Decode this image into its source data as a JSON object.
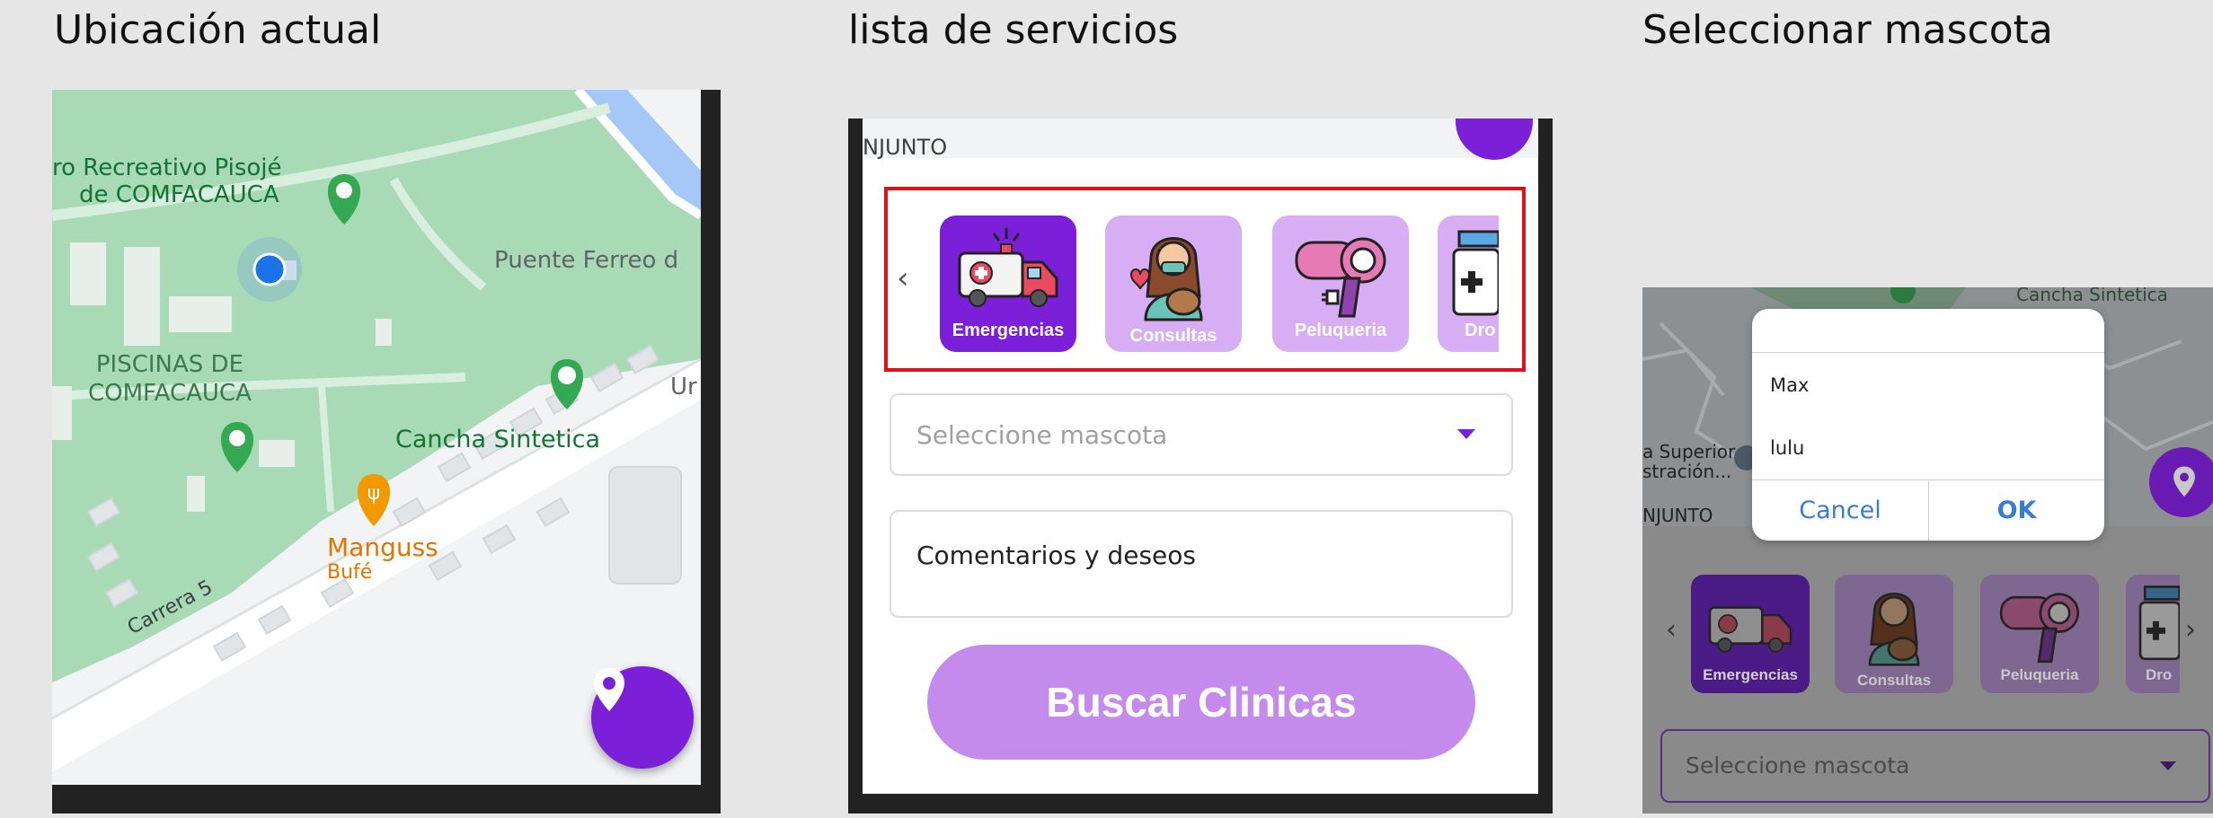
{
  "captions": {
    "left": "Ubicación actual",
    "middle": "lista de servicios",
    "right": "Seleccionar mascota"
  },
  "map1": {
    "labels": {
      "recreativo_1": "ro Recreativo Pisojé",
      "recreativo_2": "de COMFACAUCA",
      "puente": "Puente Ferreo d",
      "piscinas_1": "PISCINAS DE",
      "piscinas_2": "COMFACAUCA",
      "ur": "Ur",
      "cancha": "Cancha Sintetica",
      "manguss": "Manguss",
      "bufe": "Bufé",
      "carrera": "Carrera 5"
    }
  },
  "services": {
    "top_map_label": "NJUNTO",
    "items": [
      {
        "label": "Emergencias",
        "icon": "ambulance-icon"
      },
      {
        "label": "Consultas",
        "icon": "vet-doctor-icon"
      },
      {
        "label": "Peluqueria",
        "icon": "hair-dryer-icon"
      },
      {
        "label": "Dro",
        "icon": "medicine-bottle-icon"
      }
    ],
    "pet_placeholder": "Seleccione mascota",
    "comments_label": "Comentarios y deseos",
    "search_button": "Buscar Clinicas"
  },
  "select_pet": {
    "map_labels": {
      "cancha": "Cancha Sintetica",
      "superior_1": "a Superior",
      "superior_2": "stración...",
      "njunto": "NJUNTO"
    },
    "dialog": {
      "options": [
        "Max",
        "lulu"
      ],
      "cancel": "Cancel",
      "ok": "OK"
    },
    "items": [
      {
        "label": "Emergencias"
      },
      {
        "label": "Consultas"
      },
      {
        "label": "Peluqueria"
      },
      {
        "label": "Dro"
      }
    ],
    "pet_placeholder": "Seleccione mascota"
  },
  "colors": {
    "accent_purple": "#7b1fd8",
    "light_purple": "#d7aef3",
    "button_purple": "#c48bec",
    "park_green": "#a8dab5",
    "highlight_red": "#e0101a"
  }
}
